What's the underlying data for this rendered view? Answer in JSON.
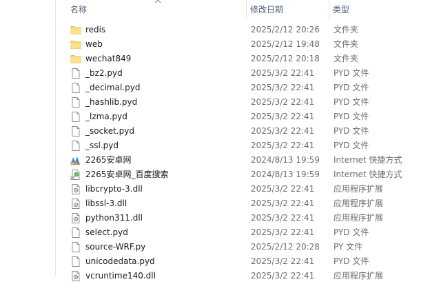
{
  "columns": {
    "name": "名称",
    "date": "修改日期",
    "type": "类型"
  },
  "files": [
    {
      "icon": "folder-icon",
      "name": "redis",
      "date": "2025/2/12 20:26",
      "type": "文件夹"
    },
    {
      "icon": "folder-icon",
      "name": "web",
      "date": "2025/2/12 19:48",
      "type": "文件夹"
    },
    {
      "icon": "folder-icon",
      "name": "wechat849",
      "date": "2025/2/12 20:18",
      "type": "文件夹"
    },
    {
      "icon": "file-icon",
      "name": "_bz2.pyd",
      "date": "2025/3/2 22:41",
      "type": "PYD 文件"
    },
    {
      "icon": "file-icon",
      "name": "_decimal.pyd",
      "date": "2025/3/2 22:41",
      "type": "PYD 文件"
    },
    {
      "icon": "file-icon",
      "name": "_hashlib.pyd",
      "date": "2025/3/2 22:41",
      "type": "PYD 文件"
    },
    {
      "icon": "file-icon",
      "name": "_lzma.pyd",
      "date": "2025/3/2 22:41",
      "type": "PYD 文件"
    },
    {
      "icon": "file-icon",
      "name": "_socket.pyd",
      "date": "2025/3/2 22:41",
      "type": "PYD 文件"
    },
    {
      "icon": "file-icon",
      "name": "_ssl.pyd",
      "date": "2025/3/2 22:41",
      "type": "PYD 文件"
    },
    {
      "icon": "site-shortcut-icon",
      "name": "2265安卓网",
      "date": "2024/8/13 19:59",
      "type": "Internet 快捷方式"
    },
    {
      "icon": "web-shortcut-icon",
      "name": "2265安卓网_百度搜索",
      "date": "2024/8/13 19:59",
      "type": "Internet 快捷方式"
    },
    {
      "icon": "dll-icon",
      "name": "libcrypto-3.dll",
      "date": "2025/3/2 22:41",
      "type": "应用程序扩展"
    },
    {
      "icon": "dll-icon",
      "name": "libssl-3.dll",
      "date": "2025/3/2 22:41",
      "type": "应用程序扩展"
    },
    {
      "icon": "dll-icon",
      "name": "python311.dll",
      "date": "2025/3/2 22:41",
      "type": "应用程序扩展"
    },
    {
      "icon": "file-icon",
      "name": "select.pyd",
      "date": "2025/3/2 22:41",
      "type": "PYD 文件"
    },
    {
      "icon": "file-icon",
      "name": "source-WRF.py",
      "date": "2025/2/12 20:28",
      "type": "PY 文件"
    },
    {
      "icon": "file-icon",
      "name": "unicodedata.pyd",
      "date": "2025/3/2 22:41",
      "type": "PYD 文件"
    },
    {
      "icon": "dll-icon",
      "name": "vcruntime140.dll",
      "date": "2025/3/2 22:41",
      "type": "应用程序扩展"
    }
  ]
}
